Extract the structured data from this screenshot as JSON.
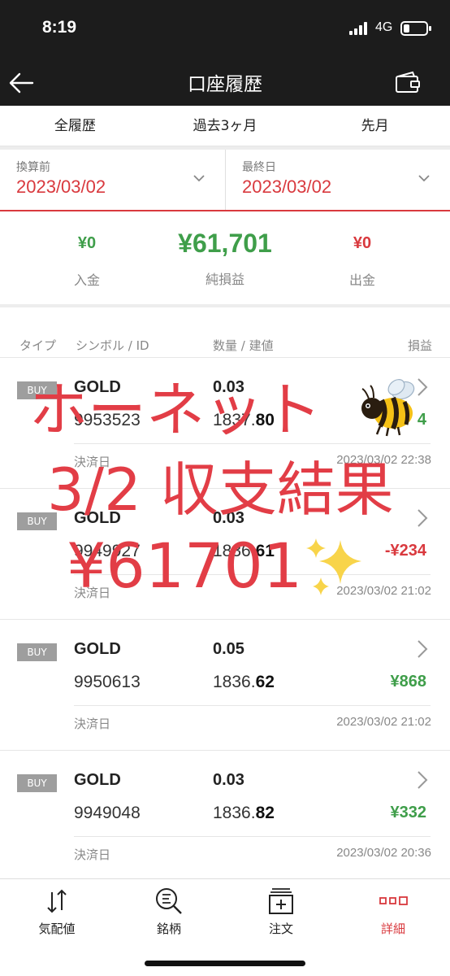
{
  "status": {
    "time": "8:19",
    "network": "4G"
  },
  "header": {
    "title": "口座履歴"
  },
  "tabs": [
    "全履歴",
    "過去3ヶ月",
    "先月"
  ],
  "dates": {
    "start": {
      "label": "換算前",
      "value": "2023/03/02"
    },
    "end": {
      "label": "最終日",
      "value": "2023/03/02"
    }
  },
  "summary": {
    "deposit": {
      "value": "¥0",
      "label": "入金"
    },
    "net": {
      "value": "¥61,701",
      "label": "純損益"
    },
    "withdraw": {
      "value": "¥0",
      "label": "出金"
    }
  },
  "table": {
    "col_type": "タイプ",
    "col_symbol": "シンボル / ID",
    "col_qty": "数量 / 建値",
    "col_pnl": "損益"
  },
  "rows": [
    {
      "type": "BUY",
      "symbol": "GOLD",
      "qty": "0.03",
      "id": "9953523",
      "price_int": "1837.",
      "price_dec": "80",
      "pnl": "4",
      "pnl_color": "#3f9e4a",
      "settle_label": "決済日",
      "settle_date": "2023/03/02 22:38"
    },
    {
      "type": "BUY",
      "symbol": "GOLD",
      "qty": "0.03",
      "id": "9949927",
      "price_int": "1836.",
      "price_dec": "61",
      "pnl": "-¥234",
      "pnl_color": "#d9393e",
      "settle_label": "決済日",
      "settle_date": "2023/03/02 21:02"
    },
    {
      "type": "BUY",
      "symbol": "GOLD",
      "qty": "0.05",
      "id": "9950613",
      "price_int": "1836.",
      "price_dec": "62",
      "pnl": "¥868",
      "pnl_color": "#3f9e4a",
      "settle_label": "決済日",
      "settle_date": "2023/03/02 21:02"
    },
    {
      "type": "BUY",
      "symbol": "GOLD",
      "qty": "0.03",
      "id": "9949048",
      "price_int": "1836.",
      "price_dec": "82",
      "pnl": "¥332",
      "pnl_color": "#3f9e4a",
      "settle_label": "決済日",
      "settle_date": "2023/03/02 20:36"
    }
  ],
  "overlay": {
    "line1": "ホーネット",
    "line2": "3/2 収支結果",
    "line3": "¥61701"
  },
  "bottom_nav": [
    {
      "label": "気配値",
      "icon": "quotes-icon"
    },
    {
      "label": "銘柄",
      "icon": "symbol-search-icon"
    },
    {
      "label": "注文",
      "icon": "order-icon"
    },
    {
      "label": "詳細",
      "icon": "details-icon",
      "active": true
    }
  ],
  "colors": {
    "accent": "#d9393e",
    "profit": "#3f9e4a",
    "header_bg": "#1c1c1c",
    "overlay_text": "#e23d46"
  }
}
